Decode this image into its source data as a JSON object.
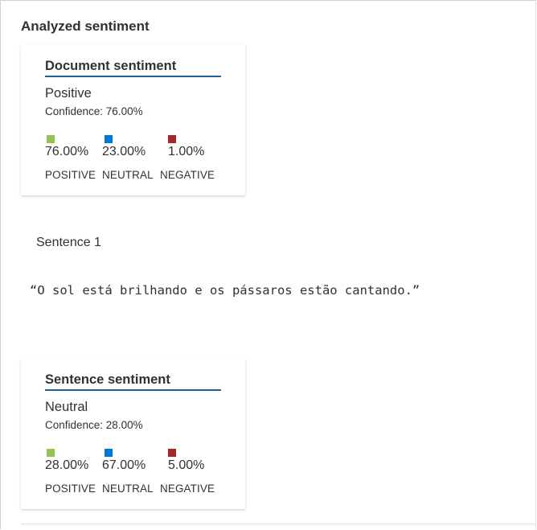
{
  "section": {
    "title": "Analyzed sentiment"
  },
  "document_card": {
    "title": "Document sentiment",
    "label": "Positive",
    "confidence": "Confidence: 76.00%",
    "scores": [
      {
        "value": "76.00%",
        "caption": "POSITIVE",
        "color": "#92c353"
      },
      {
        "value": "23.00%",
        "caption": "NEUTRAL",
        "color": "#0078d4"
      },
      {
        "value": "1.00%",
        "caption": "NEGATIVE",
        "color": "#a4262c"
      }
    ]
  },
  "sentence": {
    "heading": "Sentence 1",
    "text": "“O sol está brilhando e os pássaros estão cantando.”"
  },
  "sentence_card": {
    "title": "Sentence sentiment",
    "label": "Neutral",
    "confidence": "Confidence: 28.00%",
    "scores": [
      {
        "value": "28.00%",
        "caption": "POSITIVE",
        "color": "#92c353"
      },
      {
        "value": "67.00%",
        "caption": "NEUTRAL",
        "color": "#0078d4"
      },
      {
        "value": "5.00%",
        "caption": "NEGATIVE",
        "color": "#a4262c"
      }
    ]
  }
}
